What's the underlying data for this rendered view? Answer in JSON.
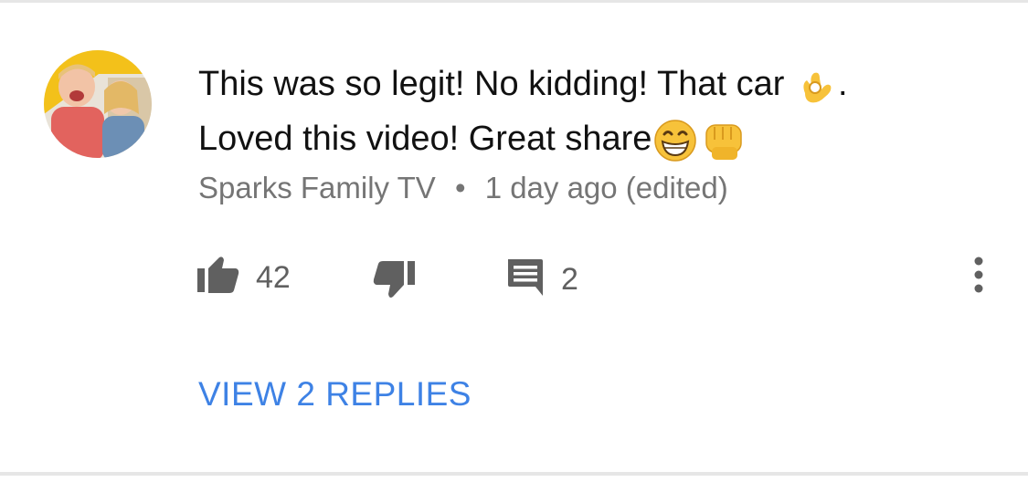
{
  "comment": {
    "avatar_icon": "channel-avatar",
    "text_line1": "This was so legit! No kidding! That car",
    "text_line1_end": ".",
    "text_line2": "Loved this video! Great share",
    "emojis": [
      "ok-hand-emoji",
      "grinning-face-emoji",
      "fist-bump-emoji"
    ],
    "author": "Sparks Family TV",
    "separator": "•",
    "time": "1 day ago (edited)"
  },
  "actions": {
    "like_icon": "thumbs-up-icon",
    "like_count": "42",
    "dislike_icon": "thumbs-down-icon",
    "reply_icon": "comment-icon",
    "reply_count": "2",
    "more_icon": "vertical-dots-icon"
  },
  "replies": {
    "label": "VIEW 2 REPLIES"
  },
  "colors": {
    "link": "#3e82e5",
    "meta_text": "#757575",
    "icon": "#606060"
  }
}
